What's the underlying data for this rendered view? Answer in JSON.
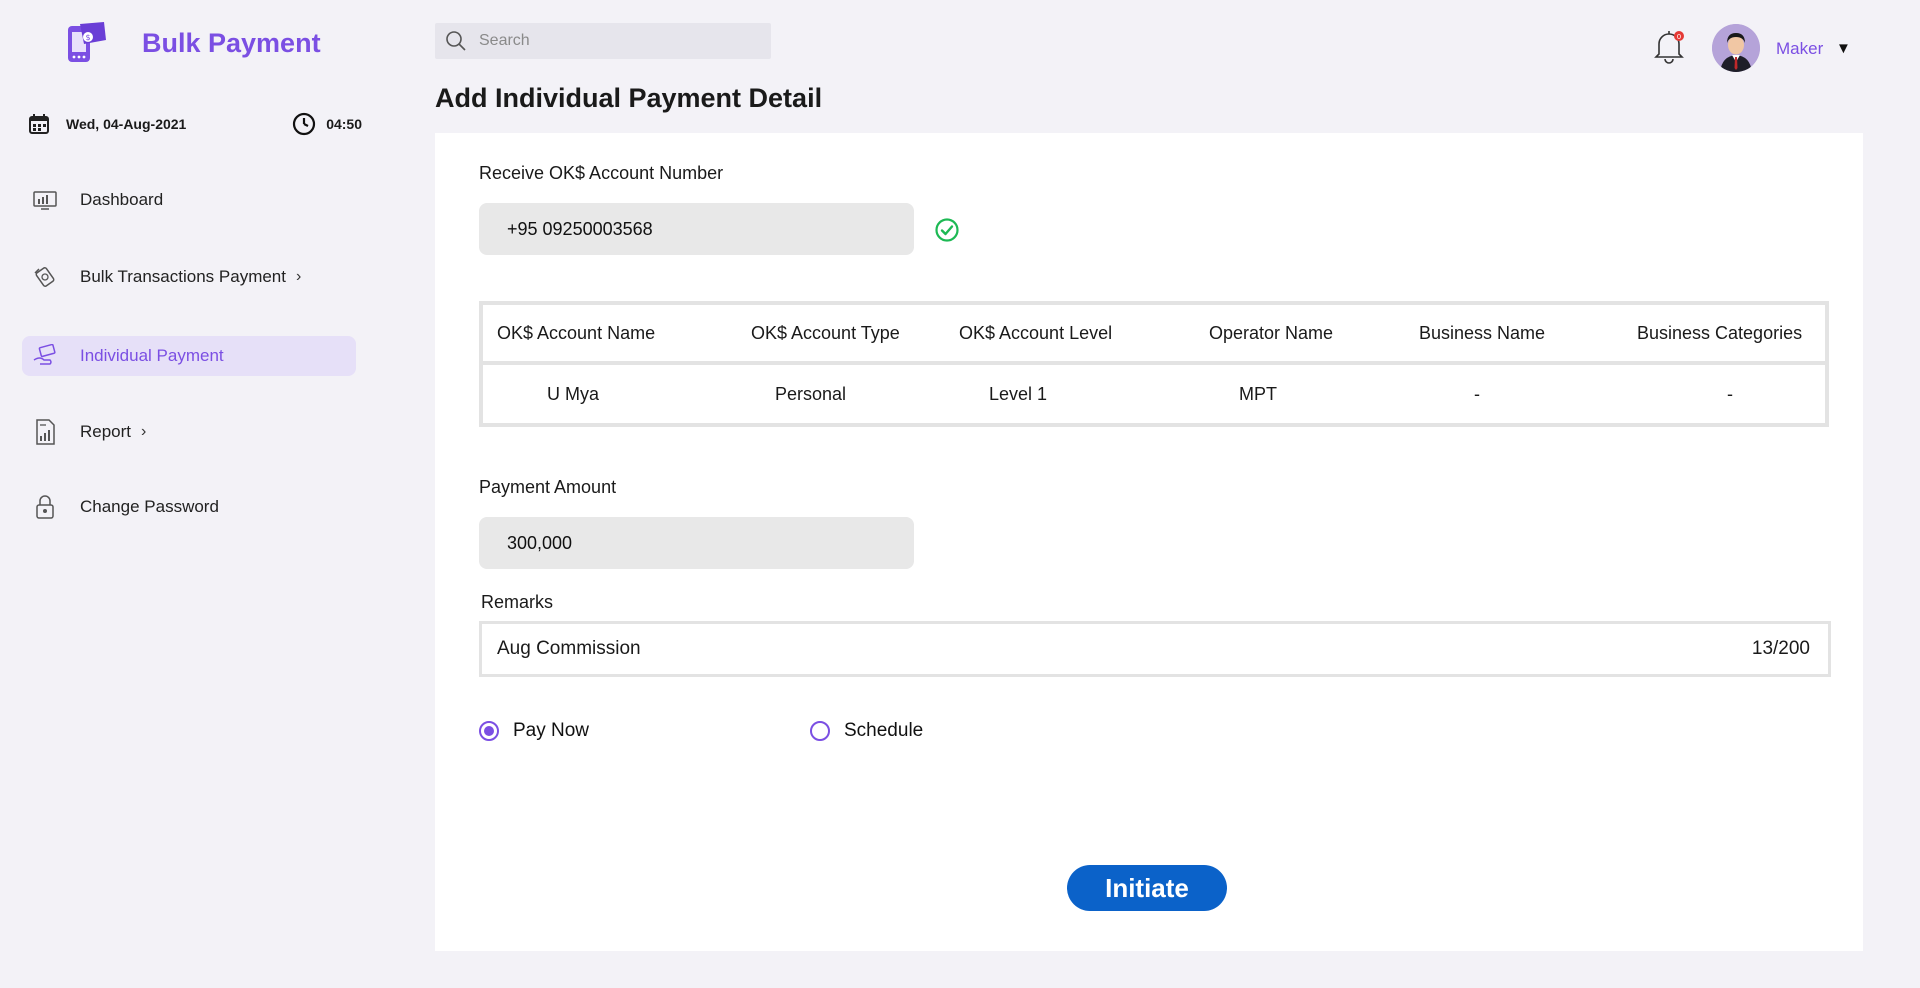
{
  "brand": {
    "title": "Bulk Payment"
  },
  "datetime": {
    "date": "Wed, 04-Aug-2021",
    "time": "04:50"
  },
  "sidebar": {
    "items": [
      {
        "label": "Dashboard",
        "icon": "dashboard-icon",
        "chevron": ""
      },
      {
        "label": "Bulk Transactions Payment",
        "icon": "bulk-transactions-icon",
        "chevron": "›"
      },
      {
        "label": "Individual Payment",
        "icon": "individual-payment-icon",
        "chevron": "",
        "active": true
      },
      {
        "label": "Report",
        "icon": "report-icon",
        "chevron": "›"
      },
      {
        "label": "Change Password",
        "icon": "lock-icon",
        "chevron": ""
      }
    ]
  },
  "search": {
    "placeholder": "Search",
    "value": ""
  },
  "header": {
    "notification_count": "0",
    "user_name": "Maker",
    "caret": "▼"
  },
  "page": {
    "title": "Add Individual Payment Detail"
  },
  "form": {
    "account_label": "Receive OK$ Account Number",
    "account_value": "+95 09250003568",
    "amount_label": "Payment Amount",
    "amount_value": "300,000",
    "remarks_label": "Remarks",
    "remarks_value": "Aug Commission",
    "remarks_count": "13/200",
    "radio_pay_now": "Pay Now",
    "radio_schedule": "Schedule",
    "selected_option": "Pay Now",
    "initiate_label": "Initiate"
  },
  "account_table": {
    "headers": [
      "OK$ Account Name",
      "OK$ Account Type",
      "OK$ Account Level",
      "Operator Name",
      "Business Name",
      "Business Categories"
    ],
    "row": [
      "U Mya",
      "Personal",
      "Level 1",
      "MPT",
      "-",
      "-"
    ]
  },
  "colors": {
    "accent": "#7b4fe3",
    "primary_button": "#0b62c9",
    "success": "#1db954",
    "background": "#f3f2f7",
    "notification_badge": "#e53935"
  }
}
